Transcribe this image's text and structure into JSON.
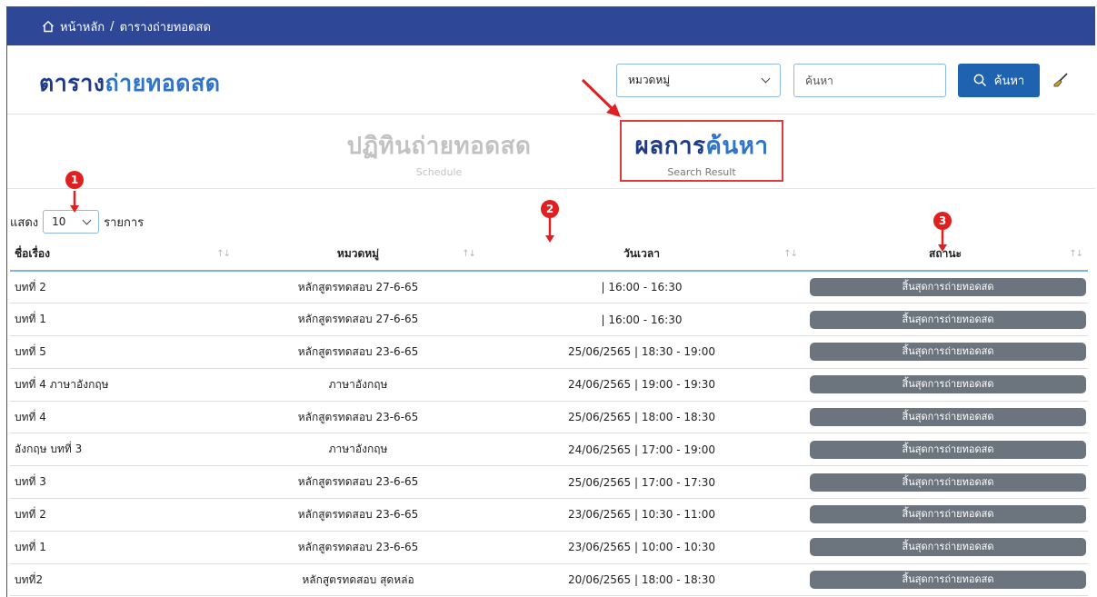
{
  "breadcrumb": {
    "home": "หน้าหลัก",
    "separator": "/",
    "current": "ตารางถ่ายทอดสด"
  },
  "header": {
    "title_part1": "ตาราง",
    "title_part2": "ถ่ายทอดสด",
    "category_select": "หมวดหมู่",
    "search_placeholder": "ค้นหา",
    "search_button": "ค้นหา"
  },
  "tabs": [
    {
      "label": "ปฏิทินถ่ายทอดสด",
      "sublabel": "Schedule"
    },
    {
      "label_part1": "ผลการ",
      "label_part2": "ค้นหา",
      "sublabel": "Search Result"
    }
  ],
  "length_menu": {
    "prefix": "แสดง",
    "value": "10",
    "suffix": "รายการ"
  },
  "table": {
    "columns": [
      "ชื่อเรื่อง",
      "หมวดหมู่",
      "วันเวลา",
      "สถานะ"
    ],
    "sort_glyph": "↑↓",
    "rows": [
      [
        "บทที่ 2",
        "หลักสูตรทดสอบ 27-6-65",
        "| 16:00 - 16:30",
        "สิ้นสุดการถ่ายทอดสด"
      ],
      [
        "บทที่ 1",
        "หลักสูตรทดสอบ 27-6-65",
        "| 16:00 - 16:30",
        "สิ้นสุดการถ่ายทอดสด"
      ],
      [
        "บทที่ 5",
        "หลักสูตรทดสอบ 23-6-65",
        "25/06/2565 | 18:30 - 19:00",
        "สิ้นสุดการถ่ายทอดสด"
      ],
      [
        "บทที่ 4 ภาษาอังกฤษ",
        "ภาษาอังกฤษ",
        "24/06/2565 | 19:00 - 19:30",
        "สิ้นสุดการถ่ายทอดสด"
      ],
      [
        "บทที่ 4",
        "หลักสูตรทดสอบ 23-6-65",
        "25/06/2565 | 18:00 - 18:30",
        "สิ้นสุดการถ่ายทอดสด"
      ],
      [
        "อังกฤษ บทที่ 3",
        "ภาษาอังกฤษ",
        "24/06/2565 | 17:00 - 19:00",
        "สิ้นสุดการถ่ายทอดสด"
      ],
      [
        "บทที่ 3",
        "หลักสูตรทดสอบ 23-6-65",
        "25/06/2565 | 17:00 - 17:30",
        "สิ้นสุดการถ่ายทอดสด"
      ],
      [
        "บทที่ 2",
        "หลักสูตรทดสอบ 23-6-65",
        "23/06/2565 | 10:30 - 11:00",
        "สิ้นสุดการถ่ายทอดสด"
      ],
      [
        "บทที่ 1",
        "หลักสูตรทดสอบ 23-6-65",
        "23/06/2565 | 10:00 - 10:30",
        "สิ้นสุดการถ่ายทอดสด"
      ],
      [
        "บทที่2",
        "หลักสูตรทดสอบ สุดหล่อ",
        "20/06/2565 | 18:00 - 18:30",
        "สิ้นสุดการถ่ายทอดสด"
      ]
    ]
  },
  "annotations": {
    "markers": [
      "1",
      "2",
      "3"
    ]
  },
  "colors": {
    "topbar": "#2f4797",
    "title": "#1e3a8a",
    "accent": "#2f74c9",
    "button": "#1f63b0",
    "badge": "#6c757d",
    "annotation": "#e02020"
  }
}
